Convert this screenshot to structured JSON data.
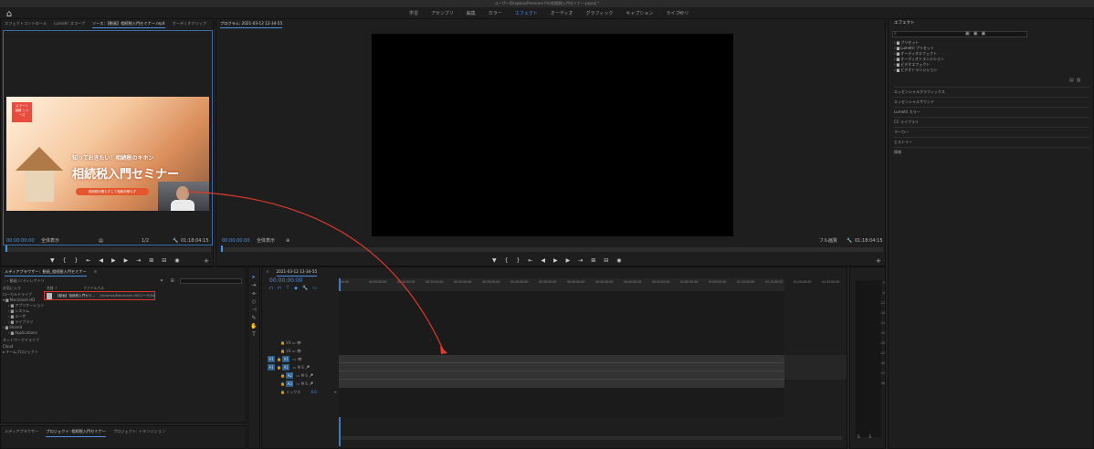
{
  "window": {
    "title": "ユーザー/Dropbox/Premiere Pro/相続税入門セミナー.prproj *"
  },
  "workspaces": {
    "tabs": [
      {
        "label": "学習"
      },
      {
        "label": "アセンブリ"
      },
      {
        "label": "編集"
      },
      {
        "label": "カラー"
      },
      {
        "label": "エフェクト"
      },
      {
        "label": "オーディオ"
      },
      {
        "label": "グラフィック"
      },
      {
        "label": "キャプション"
      },
      {
        "label": "ライブラリ"
      }
    ],
    "active_index": 4,
    "more": "»"
  },
  "source_panel": {
    "tabs": [
      "エフェクトコントロール",
      "Lumetri スコープ",
      "ソース：【動画】相続税入門セミナー.mp4",
      "オーディオクリップ"
    ],
    "active_tab": 2,
    "video": {
      "logo_text": "スマート 相続 シリーズ",
      "subtitle": "知っておきたい！相続税のキホン",
      "title": "相続税入門セミナー",
      "pill": "相続税対策もずして相続対策もず"
    },
    "timecode_in": "00:00:00:00",
    "fit": "全体表示",
    "resolution": "1/2",
    "timecode_out": "01:18:04:15"
  },
  "program_panel": {
    "tabs": [
      "プログラム: 2021-03-12 12-34-55"
    ],
    "timecode_in": "00:00:00:00",
    "fit": "全体表示",
    "resolution": "フル画質",
    "timecode_out": "01:18:04:15"
  },
  "transport": {
    "marker_icon": "▼",
    "in_icon": "{",
    "out_icon": "}",
    "go_in_icon": "⇤",
    "step_back_icon": "◀",
    "play_icon": "▶",
    "step_fwd_icon": "▶",
    "go_out_icon": "⇥",
    "insert_icon": "⊞",
    "overwrite_icon": "⊟",
    "camera_icon": "◉",
    "add_icon": "+"
  },
  "effects_panel": {
    "title": "エフェクト",
    "search_placeholder": "",
    "folders": [
      "プリセット",
      "Lumetri プリセット",
      "オーディオエフェクト",
      "オーディオトランジション",
      "ビデオエフェクト",
      "ビデオトランジション"
    ],
    "sections": [
      "エッセンシャルグラフィックス",
      "エッセンシャルサウンド",
      "Lumetri カラー",
      "CC ライブラリ",
      "マーカー",
      "ヒストリー",
      "情報"
    ]
  },
  "media_browser": {
    "tabs": [
      "メディアブラウザー：動画_相続税入門セミナー",
      "≡"
    ],
    "toolbar": {
      "filter_label": "動画",
      "directory_label": "ディレクトリ"
    },
    "tree": {
      "favorites_label": "お気に入り",
      "local_label": "ローカルドライブ",
      "items": [
        "Macintosh HD",
        "アプリケーション",
        "システム",
        "ユーザ",
        "ライブラリ",
        "Shared",
        "Applications"
      ],
      "network_label": "ネットワークドライブ",
      "cloud_label": "ネットワークドライブ",
      "cc_label": "Cloud",
      "team_label": "チームプロジェクト"
    },
    "columns": [
      "名前 ↑",
      "ファイルパス"
    ],
    "file": {
      "name": "【動画】相続税入門セミ...",
      "path": "/Volumes/Macintosh HD/ユーザ/Ha"
    }
  },
  "bottom_tabs": [
    "メディアブラウザー",
    "プロジェクト: 相続税入門セミナー",
    "プロジェクト: トランジション"
  ],
  "timeline": {
    "sequence_tab": "2021-03-12 12-34-55",
    "timecode": "00:00:00:00",
    "ruler": [
      "00:00",
      "00:05:00:00",
      "00:10:00:00",
      "00:15:00:00",
      "00:20:00:00",
      "00:25:00:00",
      "00:30:00:00",
      "00:35:00:00",
      "00:40:00:00",
      "00:45:00:00",
      "00:50:00:00",
      "00:55:00:00",
      "01:00:00:00",
      "01:05:00:00",
      "01:10:00:00",
      "01:15:00:00",
      "01:20:00:00",
      "01:25:00:00"
    ],
    "video_tracks": [
      "V3",
      "V2",
      "V1"
    ],
    "audio_tracks": [
      "A1",
      "A2",
      "A3"
    ],
    "mix_label": "ミックス",
    "mix_value": "0.0",
    "source_video_patch": "V1",
    "source_audio_patch": "A1"
  },
  "meters": {
    "labels": [
      "0",
      "-6",
      "-12",
      "-18",
      "-24",
      "-30",
      "-36",
      "-42",
      "-48",
      "-54",
      "dB"
    ],
    "solo": [
      "S",
      "S"
    ]
  },
  "annotation": {
    "arrow_color": "#e03a2a"
  }
}
